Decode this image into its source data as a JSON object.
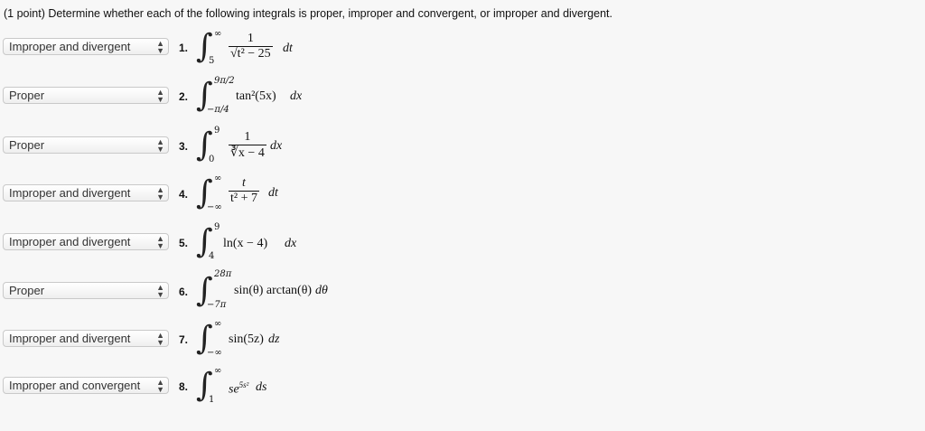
{
  "question": "(1 point) Determine whether each of the following integrals is proper, improper and convergent, or improper and divergent.",
  "items": [
    {
      "num": "1.",
      "answer": "Improper and divergent",
      "lower": "5",
      "upper": "∞",
      "numerator": "1",
      "denominator": "√t² − 25",
      "differential": "dt"
    },
    {
      "num": "2.",
      "answer": "Proper",
      "lower": "−π/4",
      "upper": "9π/2",
      "integrand": "tan²(5x)",
      "differential": "dx"
    },
    {
      "num": "3.",
      "answer": "Proper",
      "lower": "0",
      "upper": "9",
      "numerator": "1",
      "denominator": "∛x − 4",
      "differential": "dx"
    },
    {
      "num": "4.",
      "answer": "Improper and divergent",
      "lower": "−∞",
      "upper": "∞",
      "numerator": "t",
      "denominator": "t² + 7",
      "differential": "dt"
    },
    {
      "num": "5.",
      "answer": "Improper and divergent",
      "lower": "4",
      "upper": "9",
      "integrand": "ln(x − 4)",
      "differential": "dx"
    },
    {
      "num": "6.",
      "answer": "Proper",
      "lower": "−7π",
      "upper": "28π",
      "integrand": "sin(θ) arctan(θ)",
      "differential": "dθ"
    },
    {
      "num": "7.",
      "answer": "Improper and divergent",
      "lower": "−∞",
      "upper": "∞",
      "integrand": "sin(5z)",
      "differential": "dz"
    },
    {
      "num": "8.",
      "answer": "Improper and convergent",
      "lower": "1",
      "upper": "∞",
      "integrand": "se^(5s²)",
      "integrand_base": "se",
      "integrand_exp": "5s²",
      "differential": "ds"
    }
  ]
}
